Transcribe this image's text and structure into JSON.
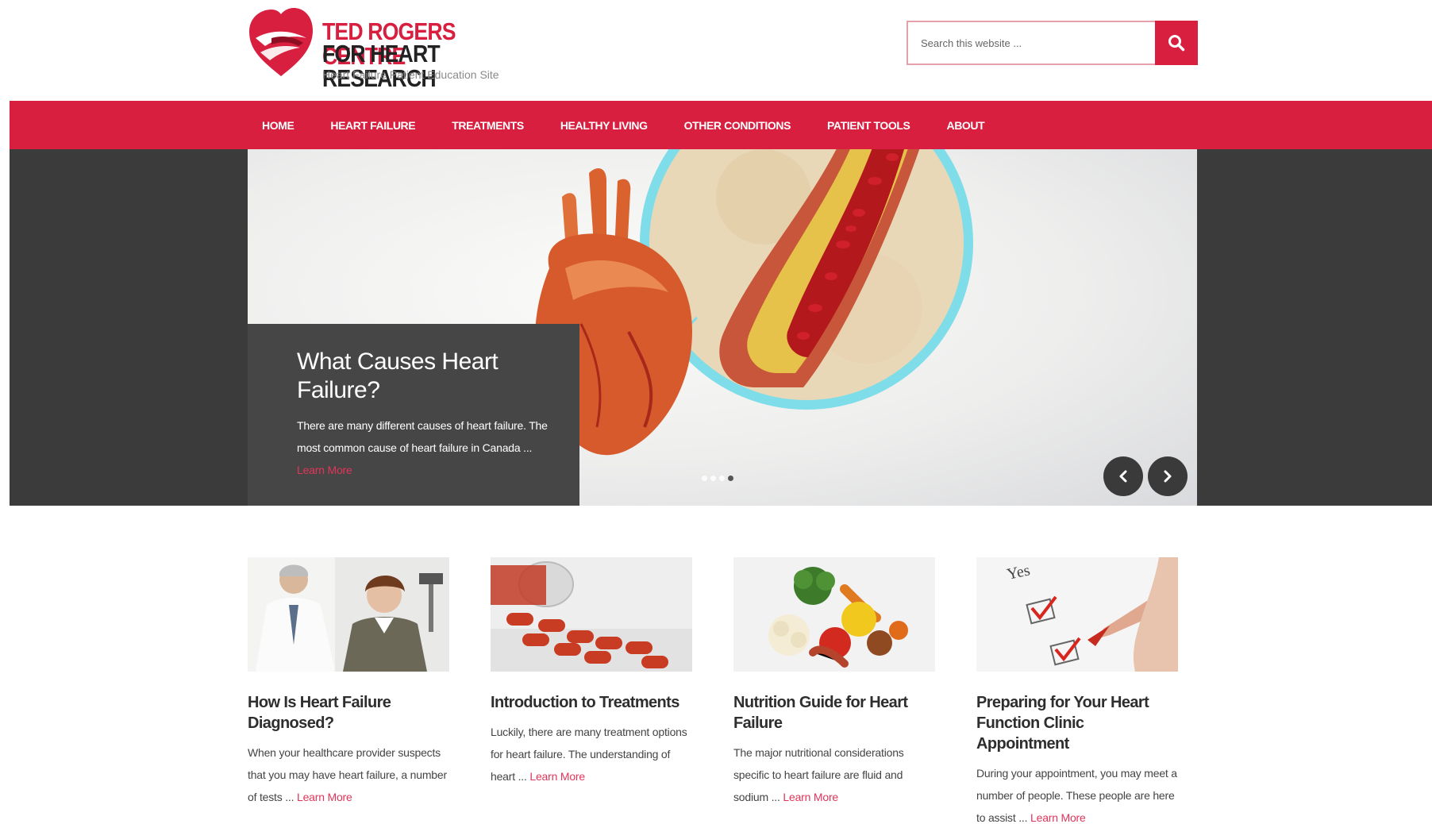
{
  "brand": {
    "line1": "TED ROGERS CENTRE",
    "line2": "FOR HEART RESEARCH",
    "tagline": "Heart Failure Patient Education Site",
    "accent_color": "#d81f3f"
  },
  "search": {
    "placeholder": "Search this website ...",
    "button_icon": "search-icon"
  },
  "nav": {
    "items": [
      "HOME",
      "HEART FAILURE",
      "TREATMENTS",
      "HEALTHY LIVING",
      "OTHER CONDITIONS",
      "PATIENT TOOLS",
      "ABOUT"
    ]
  },
  "hero": {
    "title": "What Causes Heart Failure?",
    "excerpt": "There are many different causes of heart failure. The most common cause of heart failure in Canada ...",
    "more": "Learn More",
    "slide_count": 4,
    "active_slide": 4,
    "prev_icon": "chevron-left-icon",
    "next_icon": "chevron-right-icon"
  },
  "cards": [
    {
      "title": "How Is Heart Failure Diagnosed?",
      "excerpt": "When your healthcare provider suspects that you may have heart failure, a number of tests ...",
      "more": "Learn More",
      "image": "doctor-patient-image"
    },
    {
      "title": "Introduction to Treatments",
      "excerpt": "Luckily, there are many treatment options for heart failure. The understanding of heart ...",
      "more": "Learn More",
      "image": "pills-image"
    },
    {
      "title": "Nutrition Guide for Heart Failure",
      "excerpt": "The major nutritional considerations specific to heart failure are fluid and sodium ...",
      "more": "Learn More",
      "image": "vegetables-image"
    },
    {
      "title": "Preparing for Your Heart Function Clinic Appointment",
      "excerpt": "During your appointment, you may meet a number of people. These people are here to assist ...",
      "more": "Learn More",
      "image": "checklist-image"
    }
  ]
}
